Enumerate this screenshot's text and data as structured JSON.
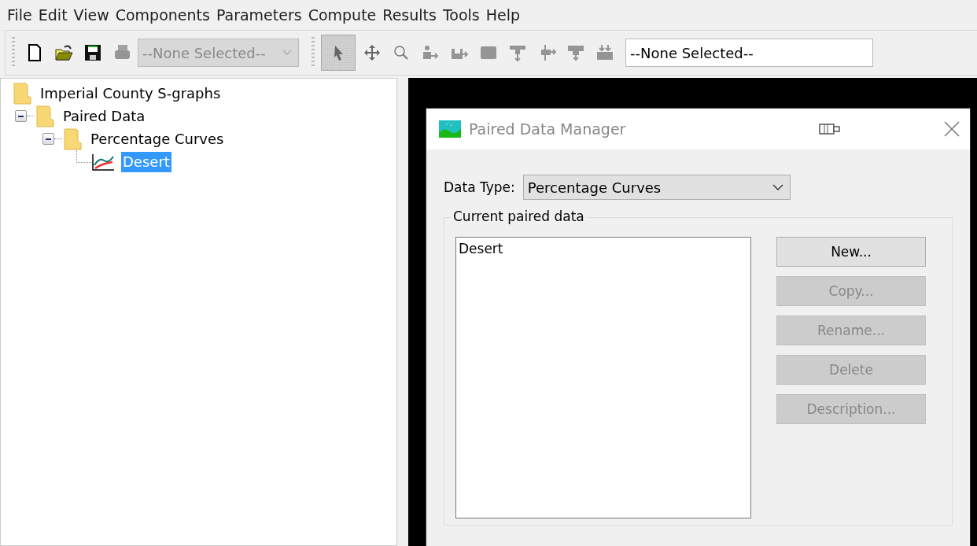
{
  "menu": [
    "File",
    "Edit",
    "View",
    "Components",
    "Parameters",
    "Compute",
    "Results",
    "Tools",
    "Help"
  ],
  "toolbar": {
    "groups": [
      [
        {
          "kind": "new",
          "disabled": false,
          "pressed": false
        },
        {
          "kind": "open",
          "disabled": false,
          "pressed": false
        },
        {
          "kind": "save",
          "disabled": false,
          "pressed": false
        },
        {
          "kind": "print",
          "disabled": true,
          "pressed": false
        }
      ],
      [
        {
          "kind": "pointer",
          "disabled": false,
          "pressed": true
        },
        {
          "kind": "move",
          "disabled": false,
          "pressed": false
        },
        {
          "kind": "zoom",
          "disabled": false,
          "pressed": false
        },
        {
          "kind": "subbasin",
          "disabled": true,
          "pressed": false
        },
        {
          "kind": "reach",
          "disabled": true,
          "pressed": false
        },
        {
          "kind": "reservoir",
          "disabled": true,
          "pressed": false
        },
        {
          "kind": "junction",
          "disabled": true,
          "pressed": false
        },
        {
          "kind": "diversion",
          "disabled": true,
          "pressed": false
        },
        {
          "kind": "source",
          "disabled": true,
          "pressed": false
        },
        {
          "kind": "sink",
          "disabled": true,
          "pressed": false
        }
      ]
    ],
    "dropdowns": [
      {
        "value": "--None Selected--",
        "disabled": true
      },
      {
        "value": "--None Selected--",
        "disabled": false
      }
    ]
  },
  "tree": [
    {
      "label": "Imperial County S-graphs",
      "kind": "folder",
      "selected": false,
      "children": [
        {
          "label": "Paired Data",
          "kind": "folder",
          "selected": false,
          "expanded": true,
          "children": [
            {
              "label": "Percentage Curves",
              "kind": "folder",
              "selected": false,
              "expanded": true,
              "children": [
                {
                  "label": "Desert",
                  "kind": "curve",
                  "selected": true
                }
              ]
            }
          ]
        }
      ]
    }
  ],
  "dialog": {
    "title": "Paired Data Manager",
    "data_type_label": "Data Type:",
    "data_type": "Percentage Curves",
    "group_label": "Current paired data",
    "items": [
      {
        "label": "Desert",
        "selected": false
      }
    ],
    "buttons": [
      {
        "label": "New...",
        "disabled": false
      },
      {
        "label": "Copy...",
        "disabled": true
      },
      {
        "label": "Rename...",
        "disabled": true
      },
      {
        "label": "Delete",
        "disabled": true
      },
      {
        "label": "Description...",
        "disabled": true
      }
    ]
  }
}
